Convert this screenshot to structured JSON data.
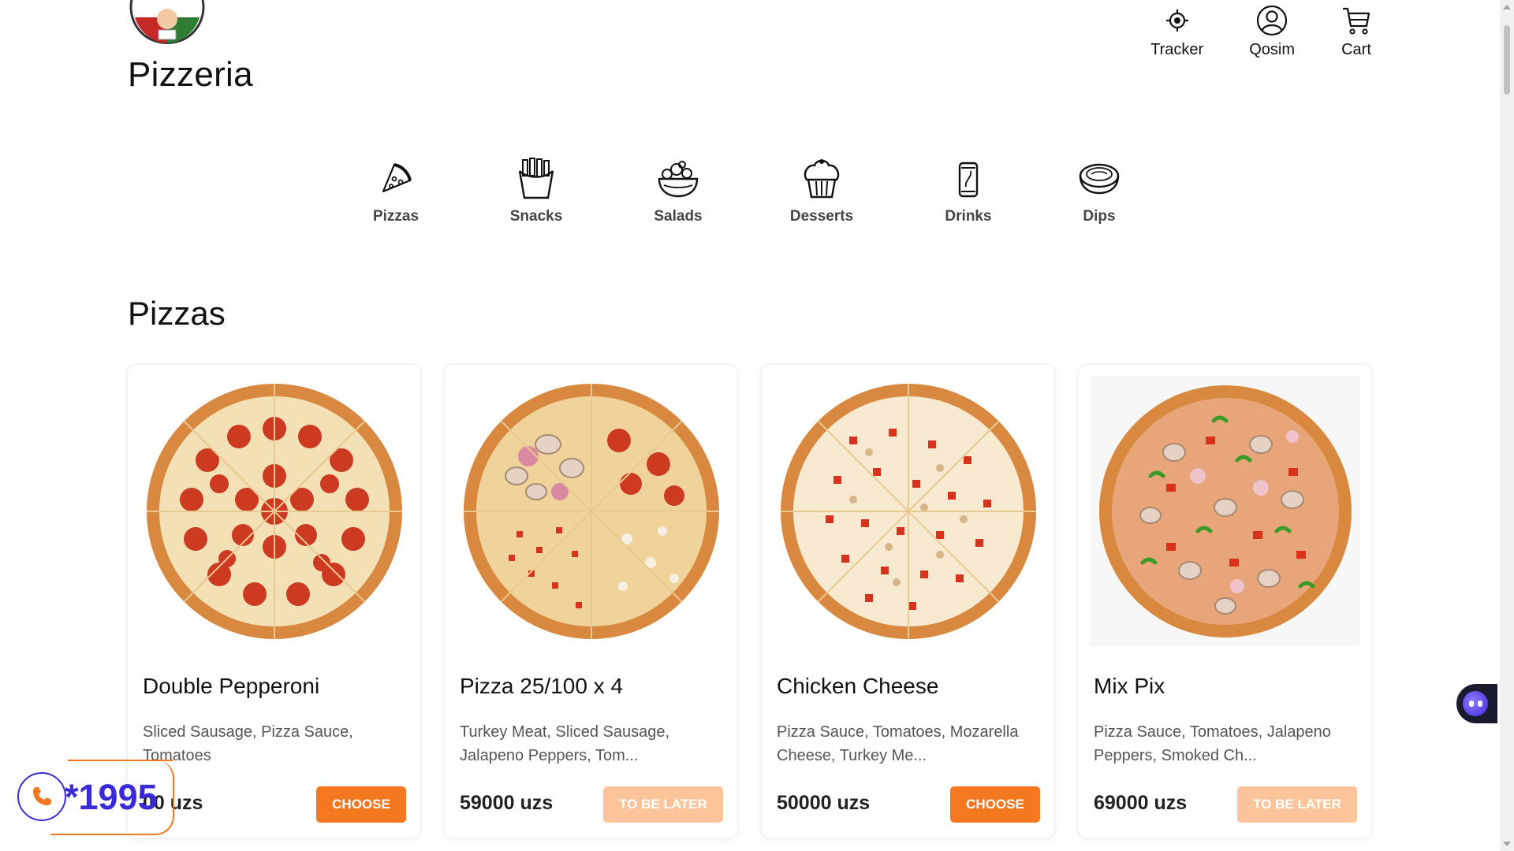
{
  "header": {
    "brand": "Pizzeria",
    "actions": [
      {
        "label": "Tracker",
        "icon": "location-target-icon"
      },
      {
        "label": "Qosim",
        "icon": "user-icon"
      },
      {
        "label": "Cart",
        "icon": "cart-icon"
      }
    ]
  },
  "categories": [
    {
      "label": "Pizzas",
      "icon": "pizza-slice-icon"
    },
    {
      "label": "Snacks",
      "icon": "fries-icon"
    },
    {
      "label": "Salads",
      "icon": "salad-bowl-icon"
    },
    {
      "label": "Desserts",
      "icon": "muffin-icon"
    },
    {
      "label": "Drinks",
      "icon": "can-icon"
    },
    {
      "label": "Dips",
      "icon": "dip-bowl-icon"
    }
  ],
  "section": {
    "title": "Pizzas"
  },
  "products": [
    {
      "name": "Double Pepperoni",
      "description": "Sliced Sausage, Pizza Sauce, Tomatoes",
      "price": "00 uzs",
      "button": "CHOOSE",
      "available": true
    },
    {
      "name": "Pizza 25/100 x 4",
      "description": "Turkey Meat, Sliced Sausage, Jalapeno Peppers, Tom...",
      "price": "59000 uzs",
      "button": "TO BE LATER",
      "available": false
    },
    {
      "name": "Chicken Cheese",
      "description": "Pizza Sauce, Tomatoes, Mozarella Cheese, Turkey Me...",
      "price": "50000 uzs",
      "button": "CHOOSE",
      "available": true
    },
    {
      "name": "Mix Pix",
      "description": "Pizza Sauce, Tomatoes, Jalapeno Peppers, Smoked Ch...",
      "price": "69000 uzs",
      "button": "TO BE LATER",
      "available": false
    }
  ],
  "phone_badge": {
    "number": "*1995",
    "icon": "phone-icon"
  },
  "chat_widget": {
    "icon": "chat-bot-icon"
  },
  "colors": {
    "accent": "#f47820",
    "accent_disabled": "#fbc49a",
    "phone": "#3a2bd8"
  }
}
